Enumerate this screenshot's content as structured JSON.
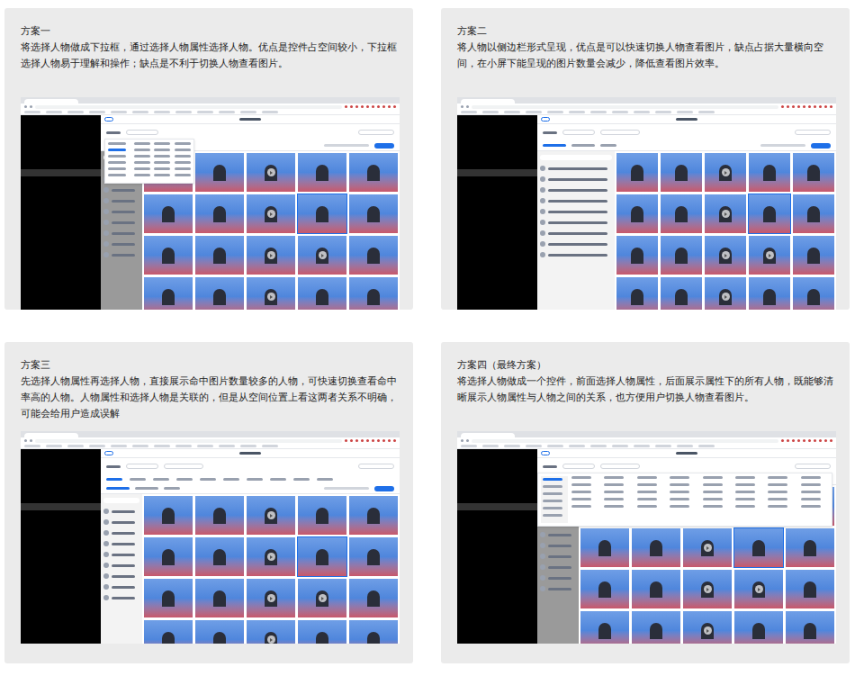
{
  "cards": [
    {
      "title": "方案一",
      "description": "将选择人物做成下拉框，通过选择人物属性选择人物。优点是控件占空间较小，下拉框选择人物易于理解和操作；缺点是不利于切换人物查看图片。",
      "kind": "dropdown"
    },
    {
      "title": "方案二",
      "description": "将人物以侧边栏形式呈现，优点是可以快速切换人物查看图片，缺点占据大量横向空间，在小屏下能呈现的图片数量会减少，降低查看图片效率。",
      "kind": "sidebar"
    },
    {
      "title": "方案三",
      "description": "先选择人物属性再选择人物，直接展示命中图片数量较多的人物，可快速切换查看命中率高的人物。人物属性和选择人物是关联的，但是从空间位置上看这两者关系不明确，可能会给用户造成误解",
      "kind": "inline"
    },
    {
      "title": "方案四（最终方案）",
      "description": "将选择人物做成一个控件，前面选择人物属性，后面展示属性下的所有人物，既能够清晰展示人物属性与人物之间的关系，也方便用户切换人物查看图片。",
      "kind": "combined"
    }
  ]
}
